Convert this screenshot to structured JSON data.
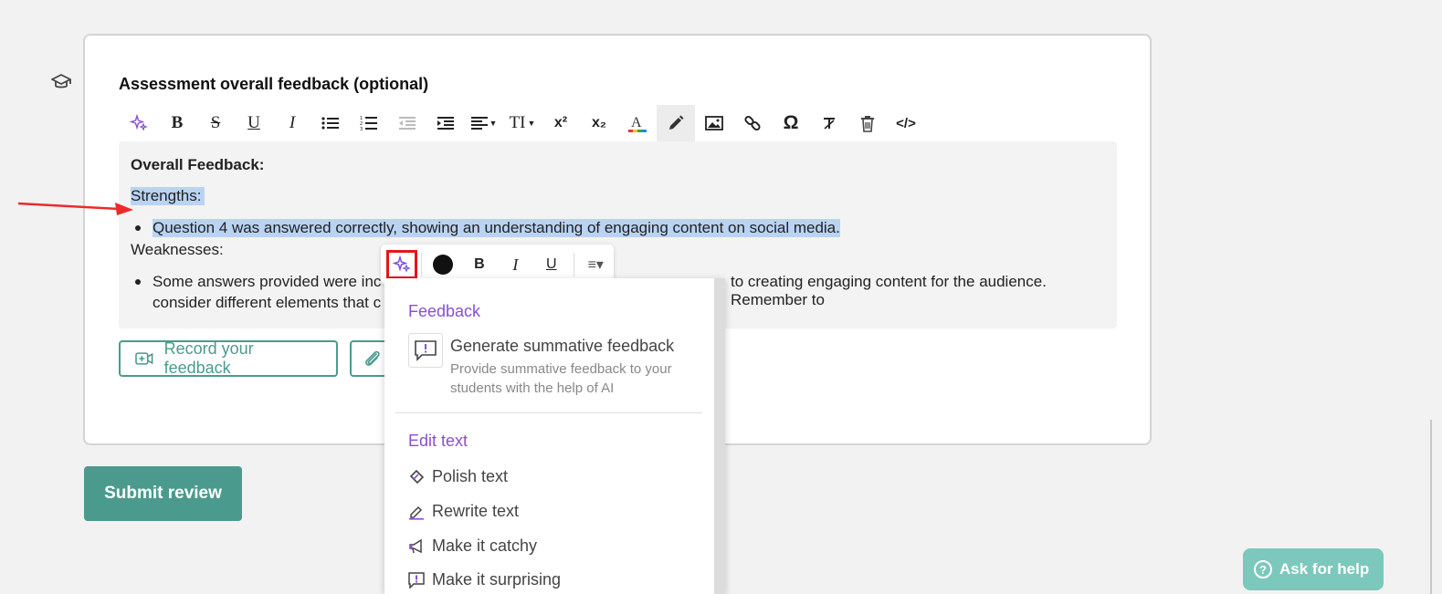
{
  "card": {
    "title": "Assessment overall feedback (optional)"
  },
  "toolbar": {
    "buttons": [
      {
        "name": "ai-sparkle",
        "glyph": "✧"
      },
      {
        "name": "bold",
        "glyph": "B"
      },
      {
        "name": "strikethrough",
        "glyph": "S"
      },
      {
        "name": "underline",
        "glyph": "U"
      },
      {
        "name": "italic",
        "glyph": "I"
      },
      {
        "name": "bullet-list",
        "glyph": "≔"
      },
      {
        "name": "numbered-list",
        "glyph": "≡"
      },
      {
        "name": "outdent",
        "glyph": "⇤"
      },
      {
        "name": "indent",
        "glyph": "⇥"
      },
      {
        "name": "align",
        "glyph": "≡"
      },
      {
        "name": "text-size",
        "glyph": "TI"
      },
      {
        "name": "superscript",
        "glyph": "x²"
      },
      {
        "name": "subscript",
        "glyph": "x₂"
      },
      {
        "name": "text-color",
        "glyph": "A"
      },
      {
        "name": "highlight",
        "glyph": "✎"
      },
      {
        "name": "image",
        "glyph": "▣"
      },
      {
        "name": "link",
        "glyph": "⛓"
      },
      {
        "name": "special-char",
        "glyph": "Ω"
      },
      {
        "name": "clear-format",
        "glyph": "T̸"
      },
      {
        "name": "delete",
        "glyph": "🗑"
      },
      {
        "name": "code",
        "glyph": "</>"
      }
    ]
  },
  "editor": {
    "heading": "Overall Feedback:",
    "strengths_label": "Strengths:",
    "strength_item": "Question 4 was answered correctly, showing an understanding of engaging content on social media.",
    "weaknesses_label": "Weaknesses:",
    "weakness_item_start": "Some answers provided were inc",
    "weakness_item_end": "to creating engaging content for the audience. Remember to",
    "weakness_item_line2": "consider different elements that c"
  },
  "buttons": {
    "record": "Record your feedback",
    "submit": "Submit review"
  },
  "float_toolbar": {
    "bold": "B",
    "italic": "I",
    "underline": "U",
    "align": "≡▾"
  },
  "menu": {
    "feedback_section": "Feedback",
    "generate_title": "Generate summative feedback",
    "generate_desc": "Provide summative feedback to your students with the help of AI",
    "edit_section": "Edit text",
    "items": [
      "Polish text",
      "Rewrite text",
      "Make it catchy",
      "Make it surprising"
    ]
  },
  "help": {
    "label": "Ask for help"
  },
  "colors": {
    "accent": "#4a9b8e",
    "purple": "#8a4fcf",
    "selection": "#b9d3f3",
    "highlight_red": "#e3161c"
  }
}
